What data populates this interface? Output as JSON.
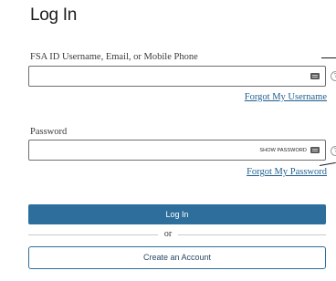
{
  "page": {
    "title": "Log In"
  },
  "username": {
    "label": "FSA ID Username, Email, or Mobile Phone",
    "value": "",
    "keyboard_icon": "keyboard-icon",
    "help_icon": "help-icon",
    "help_glyph": "?",
    "forgot_link": "Forgot My Username"
  },
  "password": {
    "label": "Password",
    "value": "",
    "show_label": "SHOW PASSWORD",
    "keyboard_icon": "keyboard-icon",
    "help_icon": "help-icon",
    "help_glyph": "?",
    "forgot_link": "Forgot My Password"
  },
  "actions": {
    "login_label": "Log In",
    "divider_text": "or",
    "create_account_label": "Create an Account"
  },
  "colors": {
    "primary": "#2e6e9c",
    "link": "#1f5f8f"
  }
}
